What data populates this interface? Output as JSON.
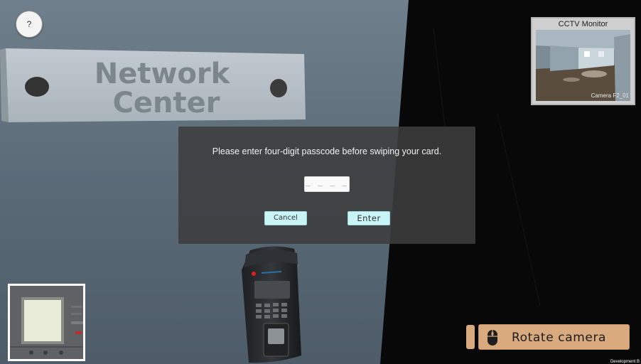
{
  "help": {
    "label": "?"
  },
  "sign": {
    "line1": "Network",
    "line2": "Center"
  },
  "cctv": {
    "title": "CCTV Monitor",
    "camera_label": "Camera F2_01"
  },
  "passcode_dialog": {
    "message": "Please enter four-digit passcode before swiping your card.",
    "input_placeholder": "_ _ _ _",
    "input_value": "",
    "cancel_label": "Cancel",
    "enter_label": "Enter"
  },
  "rotate_hint": {
    "label": "Rotate camera",
    "icon": "mouse-icon"
  },
  "build_watermark": "Development B",
  "colors": {
    "dialog_bg": "#3c3c3e",
    "button_bg": "#c9f5f7",
    "hint_bg": "#d9aa7d",
    "wall": "#5b6b78"
  }
}
